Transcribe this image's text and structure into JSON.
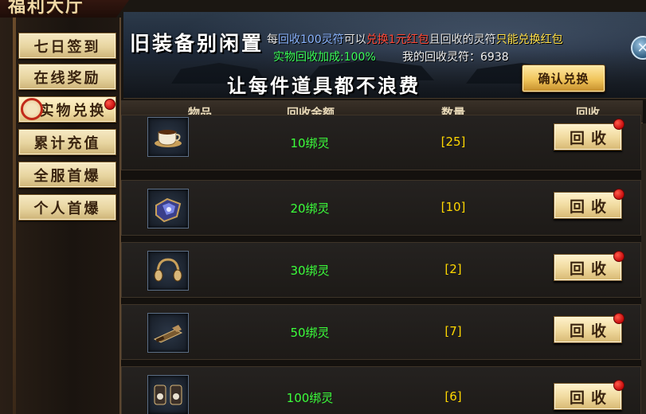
{
  "window": {
    "title": "福利大厅"
  },
  "sidebar": {
    "items": [
      {
        "label": "七日签到"
      },
      {
        "label": "在线奖励"
      },
      {
        "label": "实物兑换"
      },
      {
        "label": "累计充值"
      },
      {
        "label": "全服首爆"
      },
      {
        "label": "个人首爆"
      }
    ]
  },
  "banner": {
    "headline": "旧装备别闲置",
    "subheadline": "让每件道具都不浪费",
    "line1": {
      "p1": "每",
      "p2": "回收100灵符",
      "p3": "可以",
      "p4": "兑换1元红包",
      "p5": "且回收的灵符",
      "p6": "只能兑换红包"
    },
    "bonus": "实物回收加成:100%",
    "my_points": "我的回收灵符：6938",
    "confirm_label": "确认兑换"
  },
  "close_label": "✕",
  "table": {
    "headers": [
      "物品",
      "回收金额",
      "数量",
      "回收"
    ],
    "rows": [
      {
        "icon": "coffee-cup-icon",
        "amount": "10绑灵",
        "qty": "[25]",
        "action": "回收"
      },
      {
        "icon": "gem-armor-icon",
        "amount": "20绑灵",
        "qty": "[10]",
        "action": "回收"
      },
      {
        "icon": "headphones-icon",
        "amount": "30绑灵",
        "qty": "[2]",
        "action": "回收"
      },
      {
        "icon": "weapon-icon",
        "amount": "50绑灵",
        "qty": "[7]",
        "action": "回收"
      },
      {
        "icon": "speakers-icon",
        "amount": "100绑灵",
        "qty": "[6]",
        "action": "回收"
      }
    ]
  },
  "colors": {
    "accent_green": "#3bff3b",
    "accent_yellow": "#ffd700",
    "badge_red": "#d51010"
  }
}
